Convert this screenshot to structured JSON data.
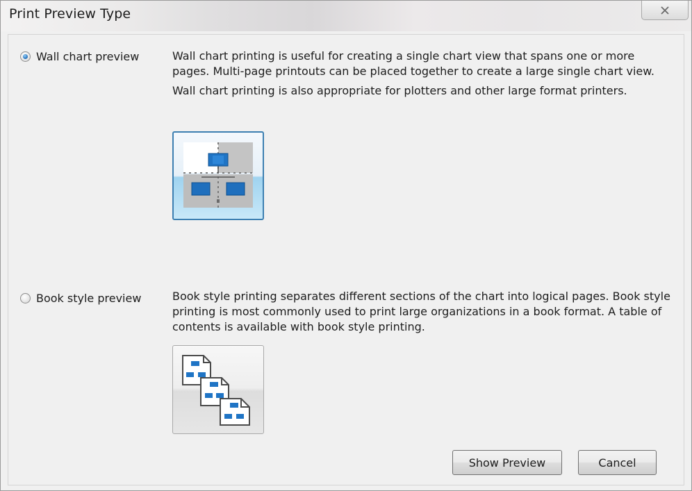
{
  "window": {
    "title": "Print Preview Type",
    "close_icon": "close-x-icon"
  },
  "options": {
    "wall_chart": {
      "label": "Wall chart preview",
      "selected": true,
      "desc_1": "Wall chart printing is useful for creating a single chart view that spans one or more pages.  Multi-page printouts can be placed together to create a large single chart view.",
      "desc_2": "Wall chart printing is also appropriate for plotters and other large format printers.",
      "image_icon": "wall-chart-preview-icon"
    },
    "book_style": {
      "label": "Book style preview",
      "selected": false,
      "desc_1": "Book style printing separates different sections of the chart into logical pages. Book style printing is most commonly used to print large organizations in a book format.  A table of contents is available with book style printing.",
      "image_icon": "book-style-preview-icon"
    }
  },
  "buttons": {
    "show_preview": "Show Preview",
    "cancel": "Cancel"
  },
  "colors": {
    "accent_blue": "#1f74c5",
    "selected_border": "#3c7fb1",
    "dialog_bg": "#f0f0f0"
  }
}
